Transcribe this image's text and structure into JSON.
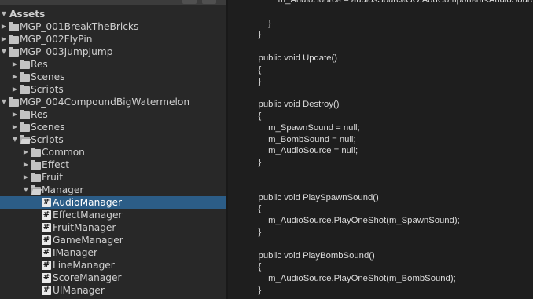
{
  "project": {
    "root_label": "Assets",
    "items": [
      {
        "label": "MGP_001BreakTheBricks",
        "type": "folder",
        "depth": 0,
        "arrow": "right"
      },
      {
        "label": "MGP_002FlyPin",
        "type": "folder",
        "depth": 0,
        "arrow": "right"
      },
      {
        "label": "MGP_003JumpJump",
        "type": "folder",
        "depth": 0,
        "arrow": "down"
      },
      {
        "label": "Res",
        "type": "folder",
        "depth": 1,
        "arrow": "right"
      },
      {
        "label": "Scenes",
        "type": "folder",
        "depth": 1,
        "arrow": "right"
      },
      {
        "label": "Scripts",
        "type": "folder",
        "depth": 1,
        "arrow": "right"
      },
      {
        "label": "MGP_004CompoundBigWatermelon",
        "type": "folder",
        "depth": 0,
        "arrow": "down"
      },
      {
        "label": "Res",
        "type": "folder",
        "depth": 1,
        "arrow": "right"
      },
      {
        "label": "Scenes",
        "type": "folder",
        "depth": 1,
        "arrow": "right"
      },
      {
        "label": "Scripts",
        "type": "folder-open",
        "depth": 1,
        "arrow": "down"
      },
      {
        "label": "Common",
        "type": "folder",
        "depth": 2,
        "arrow": "right"
      },
      {
        "label": "Effect",
        "type": "folder",
        "depth": 2,
        "arrow": "right"
      },
      {
        "label": "Fruit",
        "type": "folder",
        "depth": 2,
        "arrow": "right"
      },
      {
        "label": "Manager",
        "type": "folder-open",
        "depth": 2,
        "arrow": "down"
      },
      {
        "label": "AudioManager",
        "type": "script",
        "depth": 3,
        "selected": true
      },
      {
        "label": "EffectManager",
        "type": "script",
        "depth": 3
      },
      {
        "label": "FruitManager",
        "type": "script",
        "depth": 3
      },
      {
        "label": "GameManager",
        "type": "script",
        "depth": 3
      },
      {
        "label": "IManager",
        "type": "script",
        "depth": 3
      },
      {
        "label": "LineManager",
        "type": "script",
        "depth": 3
      },
      {
        "label": "ScoreManager",
        "type": "script",
        "depth": 3
      },
      {
        "label": "UIManager",
        "type": "script",
        "depth": 3
      }
    ]
  },
  "code": {
    "lines": [
      "            m_AudioSource = audiosSourceGO.AddComponent<AudioSource>();",
      "",
      "        }",
      "    }",
      "",
      "    public void Update()",
      "    {",
      "    }",
      "",
      "    public void Destroy()",
      "    {",
      "        m_SpawnSound = null;",
      "        m_BombSound = null;",
      "        m_AudioSource = null;",
      "    }",
      "",
      "",
      "    public void PlaySpawnSound()",
      "    {",
      "        m_AudioSource.PlayOneShot(m_SpawnSound);",
      "    }",
      "",
      "    public void PlayBombSound()",
      "    {",
      "        m_AudioSource.PlayOneShot(m_BombSound);",
      "    }"
    ]
  },
  "icons": {
    "arrow_right": "▶",
    "arrow_down": "▼",
    "script_glyph": "#"
  },
  "colors": {
    "selection": "#2c5d87",
    "panel_bg": "#282828",
    "editor_bg": "#1e1e1e"
  }
}
